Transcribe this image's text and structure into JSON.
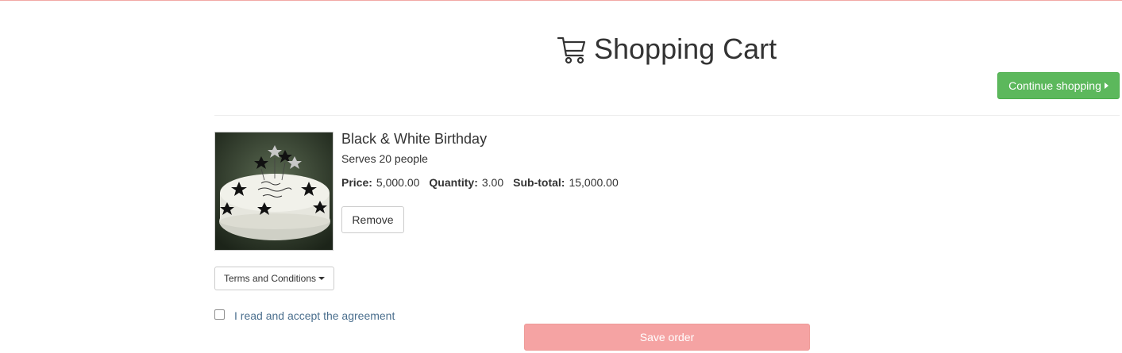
{
  "header": {
    "title": "Shopping Cart",
    "icon": "shopping-cart-icon"
  },
  "actions": {
    "continue_label": "Continue shopping",
    "continue_color": "#5cb85c"
  },
  "cart": {
    "items": [
      {
        "name": "Black & White Birthday",
        "description": "Serves 20 people",
        "price_label": "Price:",
        "price": "5,000.00",
        "quantity_label": "Quantity:",
        "quantity": "3.00",
        "subtotal_label": "Sub-total:",
        "subtotal": "15,000.00",
        "remove_label": "Remove"
      }
    ]
  },
  "terms": {
    "dropdown_label": "Terms and Conditions",
    "agreement_label": "I read and accept the agreement",
    "agreement_checked": false
  },
  "order": {
    "save_label": "Save order",
    "save_color": "#f5a3a3"
  }
}
